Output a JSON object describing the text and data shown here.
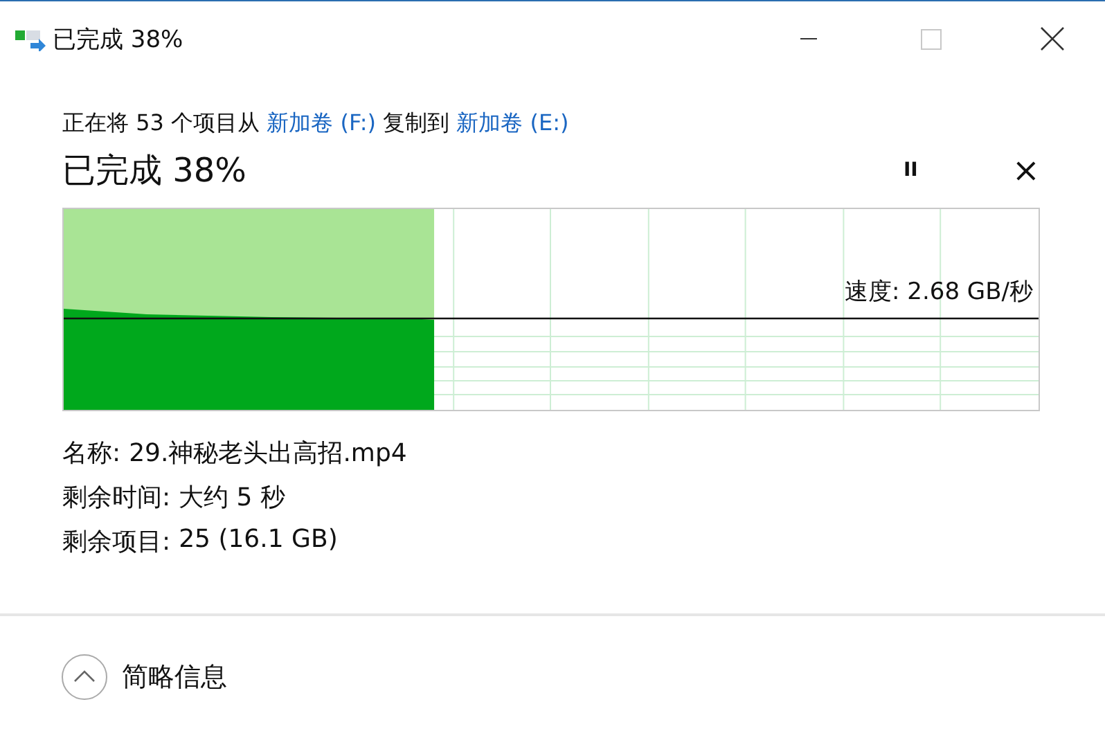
{
  "window": {
    "title": "已完成 38%",
    "maximize_disabled": true
  },
  "copy_line": {
    "prefix": "正在将 53 个项目从",
    "source": "新加卷 (F:)",
    "middle": "复制到",
    "target": "新加卷 (E:)"
  },
  "heading": "已完成 38%",
  "controls": {
    "pause": "II",
    "cancel": "×"
  },
  "progress": {
    "level": 0.38,
    "speed": "速度: 2.68 GB/秒"
  },
  "details": [
    {
      "label": "名称:",
      "value": "29.神秘老头出高招.mp4"
    },
    {
      "label": "剩余时间:",
      "value": "大约 5 秒"
    },
    {
      "label": "剩余项目:",
      "value": "25 (16.1 GB)"
    }
  ],
  "footer": {
    "toggle": "简略信息",
    "expanded": true
  }
}
